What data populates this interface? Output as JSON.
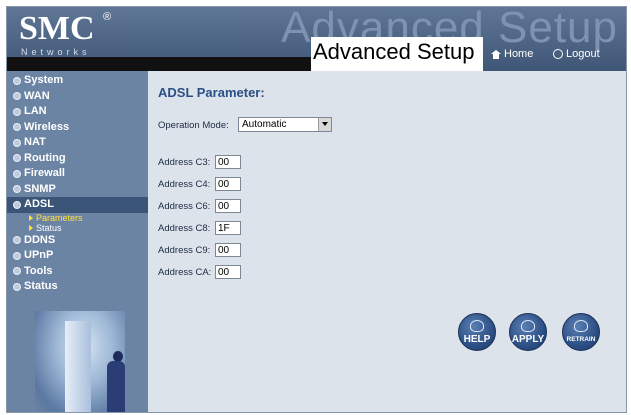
{
  "header": {
    "logo_text": "SMC",
    "logo_reg": "®",
    "logo_sub": "Networks",
    "watermark": "Advanced Setup",
    "title": "Advanced Setup",
    "home_label": "Home",
    "logout_label": "Logout"
  },
  "sidebar": {
    "items": [
      {
        "label": "System"
      },
      {
        "label": "WAN"
      },
      {
        "label": "LAN"
      },
      {
        "label": "Wireless"
      },
      {
        "label": "NAT"
      },
      {
        "label": "Routing"
      },
      {
        "label": "Firewall"
      },
      {
        "label": "SNMP"
      },
      {
        "label": "ADSL"
      },
      {
        "label": "DDNS"
      },
      {
        "label": "UPnP"
      },
      {
        "label": "Tools"
      },
      {
        "label": "Status"
      }
    ],
    "active_item": "ADSL",
    "adsl_sub": [
      {
        "label": "Parameters"
      },
      {
        "label": "Status"
      }
    ],
    "active_sub": "Parameters"
  },
  "main": {
    "title": "ADSL Parameter:",
    "operation_mode": {
      "label": "Operation Mode:",
      "value": "Automatic"
    },
    "addresses": [
      {
        "label": "Address C3:",
        "value": "00"
      },
      {
        "label": "Address C4:",
        "value": "00"
      },
      {
        "label": "Address C6:",
        "value": "00"
      },
      {
        "label": "Address C8:",
        "value": "1F"
      },
      {
        "label": "Address C9:",
        "value": "00"
      },
      {
        "label": "Address CA:",
        "value": "00"
      }
    ],
    "buttons": {
      "help": "HELP",
      "apply": "APPLY",
      "retrain": "RETRAIN"
    }
  },
  "colors": {
    "header": "#4a6284",
    "sidebar": "#6c84a4",
    "sidebar_active": "#3a5577",
    "content_bg": "#dde3ea",
    "title_blue": "#2b4f86",
    "sub_active": "#ffe040",
    "button": "#2c4f86"
  }
}
